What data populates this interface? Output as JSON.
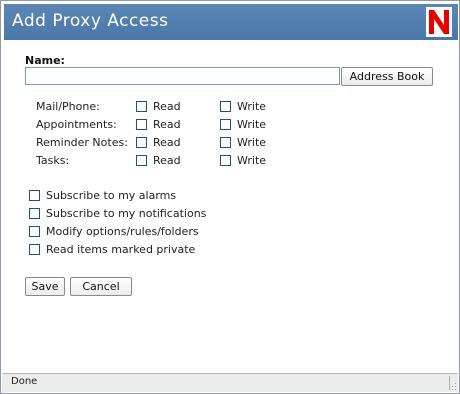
{
  "window": {
    "title": "Add Proxy Access",
    "logo_letter": "N",
    "logo_color": "#e60000",
    "titlebar_color": "#5580b0"
  },
  "name": {
    "label": "Name:",
    "value": "",
    "placeholder": "",
    "address_book_label": "Address Book"
  },
  "permissions": [
    {
      "label": "Mail/Phone:",
      "read_label": "Read",
      "write_label": "Write",
      "read_checked": false,
      "write_checked": false
    },
    {
      "label": "Appointments:",
      "read_label": "Read",
      "write_label": "Write",
      "read_checked": false,
      "write_checked": false
    },
    {
      "label": "Reminder Notes:",
      "read_label": "Read",
      "write_label": "Write",
      "read_checked": false,
      "write_checked": false
    },
    {
      "label": "Tasks:",
      "read_label": "Read",
      "write_label": "Write",
      "read_checked": false,
      "write_checked": false
    }
  ],
  "options": [
    {
      "label": "Subscribe to my alarms",
      "checked": false
    },
    {
      "label": "Subscribe to my notifications",
      "checked": false
    },
    {
      "label": "Modify options/rules/folders",
      "checked": false
    },
    {
      "label": "Read items marked private",
      "checked": false
    }
  ],
  "actions": {
    "save_label": "Save",
    "cancel_label": "Cancel"
  },
  "status": {
    "text": "Done"
  }
}
